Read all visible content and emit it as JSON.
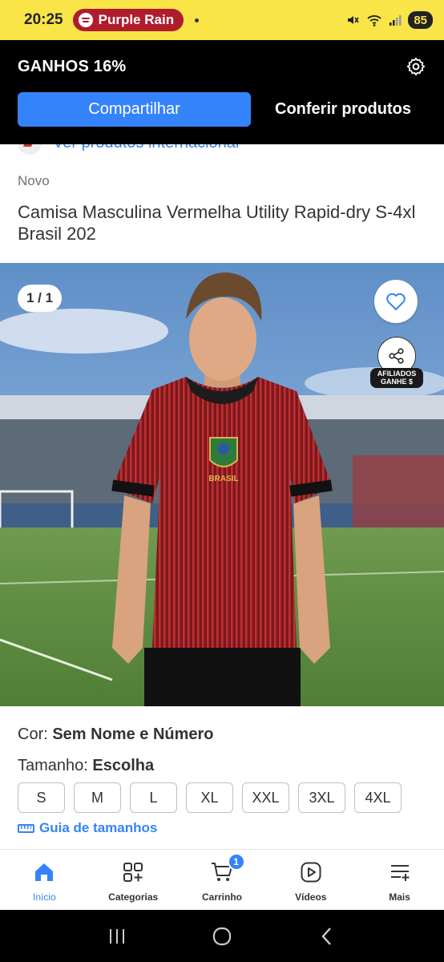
{
  "status_bar": {
    "time": "20:25",
    "now_playing": "Purple Rain",
    "battery": "85",
    "icons": [
      "spotify-icon",
      "mute-icon",
      "wifi-icon",
      "signal-icon",
      "battery-icon"
    ]
  },
  "header": {
    "earnings_title": "GANHOS 16%",
    "share_label": "Compartilhar",
    "check_products_label": "Conferir produtos",
    "settings_icon": "gear-icon"
  },
  "intl_link": "Ver produtos internacional",
  "product": {
    "condition": "Novo",
    "title": "Camisa Masculina Vermelha Utility Rapid-dry S-4xl Brasil 202",
    "image_counter": "1 / 1",
    "affiliate_tag_line1": "AFILIADOS",
    "affiliate_tag_line2": "GANHE $",
    "shirt_badge": "BRASIL"
  },
  "options": {
    "color_label": "Cor: ",
    "color_value": "Sem Nome e Número",
    "size_label": "Tamanho: ",
    "size_value": "Escolha",
    "sizes": [
      "S",
      "M",
      "L",
      "XL",
      "XXL",
      "3XL",
      "4XL"
    ],
    "size_guide": "Guia de tamanhos"
  },
  "bottom_nav": {
    "items": [
      {
        "label": "Início",
        "icon": "home-icon",
        "active": true
      },
      {
        "label": "Categorias",
        "icon": "categories-icon"
      },
      {
        "label": "Carrinho",
        "icon": "cart-icon",
        "badge": "1"
      },
      {
        "label": "Vídeos",
        "icon": "video-icon"
      },
      {
        "label": "Mais",
        "icon": "more-icon"
      }
    ]
  },
  "colors": {
    "status_bar_bg": "#f9e547",
    "header_bg": "#000000",
    "accent_blue": "#3483fa",
    "spotify_pill": "#b01c2e"
  }
}
